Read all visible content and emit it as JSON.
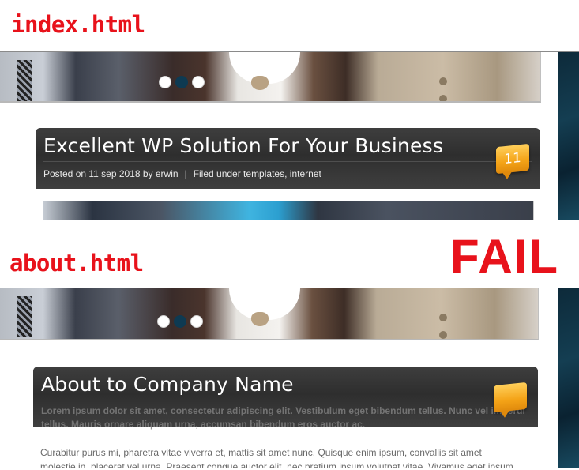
{
  "labels": {
    "index_file": "index.html",
    "about_file": "about.html",
    "verdict": "FAIL"
  },
  "slider": {
    "dots": 3,
    "active_index": 1
  },
  "index_page": {
    "post_title": "Excellent WP Solution For Your Business",
    "meta": {
      "posted_on": "Posted on 11 sep 2018 by erwin",
      "separator": "|",
      "filed_under": "Filed under templates",
      "tag_sep": ",",
      "tag2": "internet"
    },
    "comment_count": "11"
  },
  "about_page": {
    "title": "About to Company Name",
    "intro_overlap_line1": "Lorem ipsum dolor sit amet, consectetur adipiscing elit. Vestibulum eget bibendum tellus. Nunc vel imperdiet",
    "intro_overlap_line2": "tellus. Mauris ornare aliquam urna, accumsan bibendum eros auctor ac.",
    "body_line1": "Curabitur purus mi, pharetra vitae viverra et, mattis sit amet nunc. Quisque enim ipsum, convallis sit amet",
    "body_line2": "molestie in, placerat vel urna. Praesent congue auctor elit, nec pretium ipsum volutpat vitae. Vivamus eget ipsum"
  },
  "colors": {
    "label_red": "#e8121b",
    "header_dark": "#333333",
    "badge_orange": "#f4a317",
    "slider_active": "#0e3a52"
  }
}
